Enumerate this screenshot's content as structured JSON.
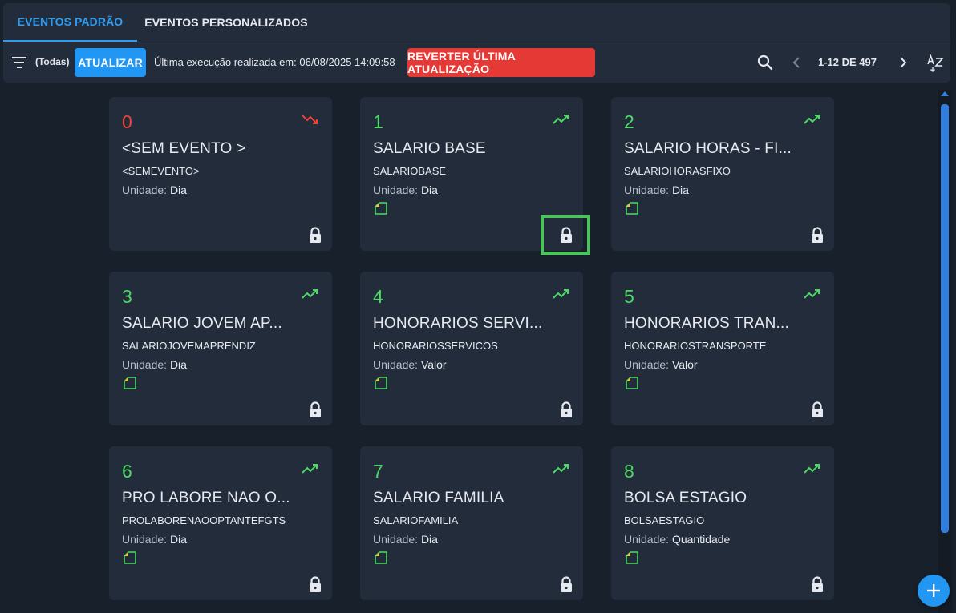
{
  "tabs": [
    {
      "label": "EVENTOS PADRÃO",
      "active": true
    },
    {
      "label": "EVENTOS PERSONALIZADOS",
      "active": false
    }
  ],
  "toolbar": {
    "filter_label": "(Todas)",
    "update_label": "ATUALIZAR",
    "last_execution": "Última execução realizada em: 06/08/2025 14:09:58",
    "revert_label": "REVERTER ÚLTIMA ATUALIZAÇÃO",
    "pagination": "1-12 DE 497"
  },
  "unit_prefix": "Unidade:",
  "colors": {
    "accent": "#2196f3",
    "positive": "#4cd964",
    "negative": "#f0413a",
    "danger_button": "#e53935",
    "highlight": "#4cc35b"
  },
  "cards": [
    {
      "number": "0",
      "title": "<SEM EVENTO >",
      "code": "<SEMEVENTO>",
      "unit": "Dia",
      "trend": "down",
      "has_doc": false
    },
    {
      "number": "1",
      "title": "SALARIO BASE",
      "code": "SALARIOBASE",
      "unit": "Dia",
      "trend": "up",
      "has_doc": true
    },
    {
      "number": "2",
      "title": "SALARIO HORAS - FI...",
      "code": "SALARIOHORASFIXO",
      "unit": "Dia",
      "trend": "up",
      "has_doc": true
    },
    {
      "number": "3",
      "title": "SALARIO JOVEM AP...",
      "code": "SALARIOJOVEMAPRENDIZ",
      "unit": "Dia",
      "trend": "up",
      "has_doc": true
    },
    {
      "number": "4",
      "title": "HONORARIOS SERVI...",
      "code": "HONORARIOSSERVICOS",
      "unit": "Valor",
      "trend": "up",
      "has_doc": true
    },
    {
      "number": "5",
      "title": "HONORARIOS TRAN...",
      "code": "HONORARIOSTRANSPORTE",
      "unit": "Valor",
      "trend": "up",
      "has_doc": true
    },
    {
      "number": "6",
      "title": "PRO LABORE NAO O...",
      "code": "PROLABORENAOOPTANTEFGTS",
      "unit": "Dia",
      "trend": "up",
      "has_doc": true
    },
    {
      "number": "7",
      "title": "SALARIO FAMILIA",
      "code": "SALARIOFAMILIA",
      "unit": "Dia",
      "trend": "up",
      "has_doc": true
    },
    {
      "number": "8",
      "title": "BOLSA ESTAGIO",
      "code": "BOLSAESTAGIO",
      "unit": "Quantidade",
      "trend": "up",
      "has_doc": true
    }
  ]
}
